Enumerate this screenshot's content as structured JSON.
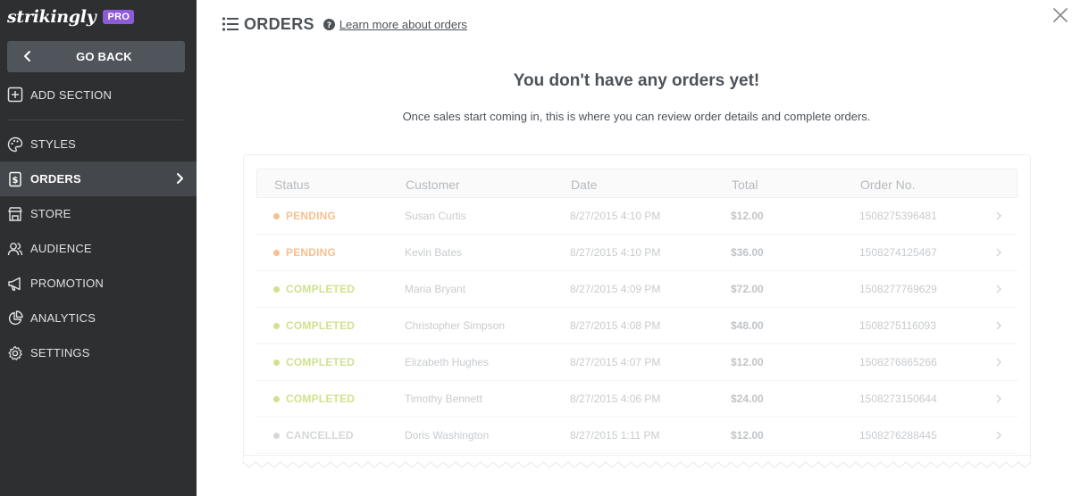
{
  "brand": {
    "logo": "strikingly",
    "badge": "PRO"
  },
  "sidebar": {
    "go_back": "GO BACK",
    "add_section": "ADD SECTION",
    "items": [
      {
        "label": "STYLES",
        "icon": "palette-icon",
        "active": false
      },
      {
        "label": "ORDERS",
        "icon": "dollar-file-icon",
        "active": true
      },
      {
        "label": "STORE",
        "icon": "store-icon",
        "active": false
      },
      {
        "label": "AUDIENCE",
        "icon": "people-icon",
        "active": false
      },
      {
        "label": "PROMOTION",
        "icon": "megaphone-icon",
        "active": false
      },
      {
        "label": "ANALYTICS",
        "icon": "pie-chart-icon",
        "active": false
      },
      {
        "label": "SETTINGS",
        "icon": "gear-icon",
        "active": false
      }
    ]
  },
  "header": {
    "title": "ORDERS",
    "learn_more": "Learn more about orders"
  },
  "empty": {
    "title": "You don't have any orders yet!",
    "subtitle": "Once sales start coming in, this is where you can review order details and complete orders."
  },
  "table": {
    "columns": [
      "Status",
      "Customer",
      "Date",
      "Total",
      "Order No."
    ],
    "rows": [
      {
        "status": "PENDING",
        "customer": "Susan Curtis",
        "date": "8/27/2015 4:10 PM",
        "total": "$12.00",
        "order_no": "1508275396481"
      },
      {
        "status": "PENDING",
        "customer": "Kevin Bates",
        "date": "8/27/2015 4:10 PM",
        "total": "$36.00",
        "order_no": "1508274125467"
      },
      {
        "status": "COMPLETED",
        "customer": "Maria Bryant",
        "date": "8/27/2015 4:09 PM",
        "total": "$72.00",
        "order_no": "1508277769629"
      },
      {
        "status": "COMPLETED",
        "customer": "Christopher Simpson",
        "date": "8/27/2015 4:08 PM",
        "total": "$48.00",
        "order_no": "1508275116093"
      },
      {
        "status": "COMPLETED",
        "customer": "Elizabeth Hughes",
        "date": "8/27/2015 4:07 PM",
        "total": "$12.00",
        "order_no": "1508276865266"
      },
      {
        "status": "COMPLETED",
        "customer": "Timothy Bennett",
        "date": "8/27/2015 4:06 PM",
        "total": "$24.00",
        "order_no": "1508273150644"
      },
      {
        "status": "CANCELLED",
        "customer": "Doris Washington",
        "date": "8/27/2015 1:11 PM",
        "total": "$12.00",
        "order_no": "1508276288445"
      }
    ]
  },
  "colors": {
    "sidebar_bg": "#2d2f31",
    "pending": "#f7c08f",
    "completed": "#cfe28e",
    "cancelled": "#d5d7d9",
    "badge": "#8e5bd6"
  }
}
